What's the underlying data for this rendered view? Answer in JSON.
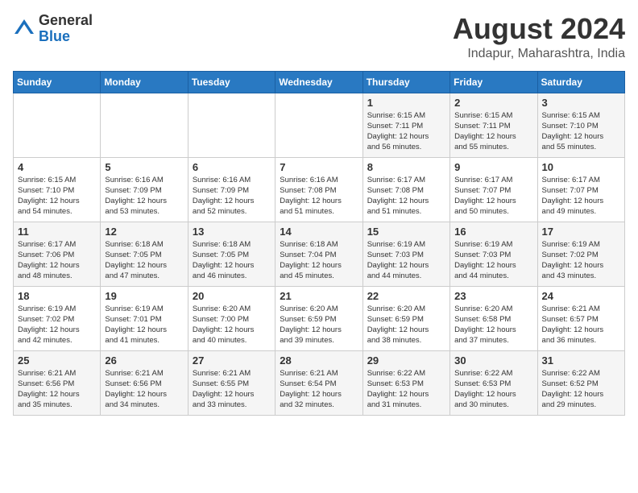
{
  "header": {
    "logo_general": "General",
    "logo_blue": "Blue",
    "month_year": "August 2024",
    "location": "Indapur, Maharashtra, India"
  },
  "days_of_week": [
    "Sunday",
    "Monday",
    "Tuesday",
    "Wednesday",
    "Thursday",
    "Friday",
    "Saturday"
  ],
  "weeks": [
    [
      {
        "day": "",
        "info": ""
      },
      {
        "day": "",
        "info": ""
      },
      {
        "day": "",
        "info": ""
      },
      {
        "day": "",
        "info": ""
      },
      {
        "day": "1",
        "info": "Sunrise: 6:15 AM\nSunset: 7:11 PM\nDaylight: 12 hours\nand 56 minutes."
      },
      {
        "day": "2",
        "info": "Sunrise: 6:15 AM\nSunset: 7:11 PM\nDaylight: 12 hours\nand 55 minutes."
      },
      {
        "day": "3",
        "info": "Sunrise: 6:15 AM\nSunset: 7:10 PM\nDaylight: 12 hours\nand 55 minutes."
      }
    ],
    [
      {
        "day": "4",
        "info": "Sunrise: 6:15 AM\nSunset: 7:10 PM\nDaylight: 12 hours\nand 54 minutes."
      },
      {
        "day": "5",
        "info": "Sunrise: 6:16 AM\nSunset: 7:09 PM\nDaylight: 12 hours\nand 53 minutes."
      },
      {
        "day": "6",
        "info": "Sunrise: 6:16 AM\nSunset: 7:09 PM\nDaylight: 12 hours\nand 52 minutes."
      },
      {
        "day": "7",
        "info": "Sunrise: 6:16 AM\nSunset: 7:08 PM\nDaylight: 12 hours\nand 51 minutes."
      },
      {
        "day": "8",
        "info": "Sunrise: 6:17 AM\nSunset: 7:08 PM\nDaylight: 12 hours\nand 51 minutes."
      },
      {
        "day": "9",
        "info": "Sunrise: 6:17 AM\nSunset: 7:07 PM\nDaylight: 12 hours\nand 50 minutes."
      },
      {
        "day": "10",
        "info": "Sunrise: 6:17 AM\nSunset: 7:07 PM\nDaylight: 12 hours\nand 49 minutes."
      }
    ],
    [
      {
        "day": "11",
        "info": "Sunrise: 6:17 AM\nSunset: 7:06 PM\nDaylight: 12 hours\nand 48 minutes."
      },
      {
        "day": "12",
        "info": "Sunrise: 6:18 AM\nSunset: 7:05 PM\nDaylight: 12 hours\nand 47 minutes."
      },
      {
        "day": "13",
        "info": "Sunrise: 6:18 AM\nSunset: 7:05 PM\nDaylight: 12 hours\nand 46 minutes."
      },
      {
        "day": "14",
        "info": "Sunrise: 6:18 AM\nSunset: 7:04 PM\nDaylight: 12 hours\nand 45 minutes."
      },
      {
        "day": "15",
        "info": "Sunrise: 6:19 AM\nSunset: 7:03 PM\nDaylight: 12 hours\nand 44 minutes."
      },
      {
        "day": "16",
        "info": "Sunrise: 6:19 AM\nSunset: 7:03 PM\nDaylight: 12 hours\nand 44 minutes."
      },
      {
        "day": "17",
        "info": "Sunrise: 6:19 AM\nSunset: 7:02 PM\nDaylight: 12 hours\nand 43 minutes."
      }
    ],
    [
      {
        "day": "18",
        "info": "Sunrise: 6:19 AM\nSunset: 7:02 PM\nDaylight: 12 hours\nand 42 minutes."
      },
      {
        "day": "19",
        "info": "Sunrise: 6:19 AM\nSunset: 7:01 PM\nDaylight: 12 hours\nand 41 minutes."
      },
      {
        "day": "20",
        "info": "Sunrise: 6:20 AM\nSunset: 7:00 PM\nDaylight: 12 hours\nand 40 minutes."
      },
      {
        "day": "21",
        "info": "Sunrise: 6:20 AM\nSunset: 6:59 PM\nDaylight: 12 hours\nand 39 minutes."
      },
      {
        "day": "22",
        "info": "Sunrise: 6:20 AM\nSunset: 6:59 PM\nDaylight: 12 hours\nand 38 minutes."
      },
      {
        "day": "23",
        "info": "Sunrise: 6:20 AM\nSunset: 6:58 PM\nDaylight: 12 hours\nand 37 minutes."
      },
      {
        "day": "24",
        "info": "Sunrise: 6:21 AM\nSunset: 6:57 PM\nDaylight: 12 hours\nand 36 minutes."
      }
    ],
    [
      {
        "day": "25",
        "info": "Sunrise: 6:21 AM\nSunset: 6:56 PM\nDaylight: 12 hours\nand 35 minutes."
      },
      {
        "day": "26",
        "info": "Sunrise: 6:21 AM\nSunset: 6:56 PM\nDaylight: 12 hours\nand 34 minutes."
      },
      {
        "day": "27",
        "info": "Sunrise: 6:21 AM\nSunset: 6:55 PM\nDaylight: 12 hours\nand 33 minutes."
      },
      {
        "day": "28",
        "info": "Sunrise: 6:21 AM\nSunset: 6:54 PM\nDaylight: 12 hours\nand 32 minutes."
      },
      {
        "day": "29",
        "info": "Sunrise: 6:22 AM\nSunset: 6:53 PM\nDaylight: 12 hours\nand 31 minutes."
      },
      {
        "day": "30",
        "info": "Sunrise: 6:22 AM\nSunset: 6:53 PM\nDaylight: 12 hours\nand 30 minutes."
      },
      {
        "day": "31",
        "info": "Sunrise: 6:22 AM\nSunset: 6:52 PM\nDaylight: 12 hours\nand 29 minutes."
      }
    ]
  ]
}
